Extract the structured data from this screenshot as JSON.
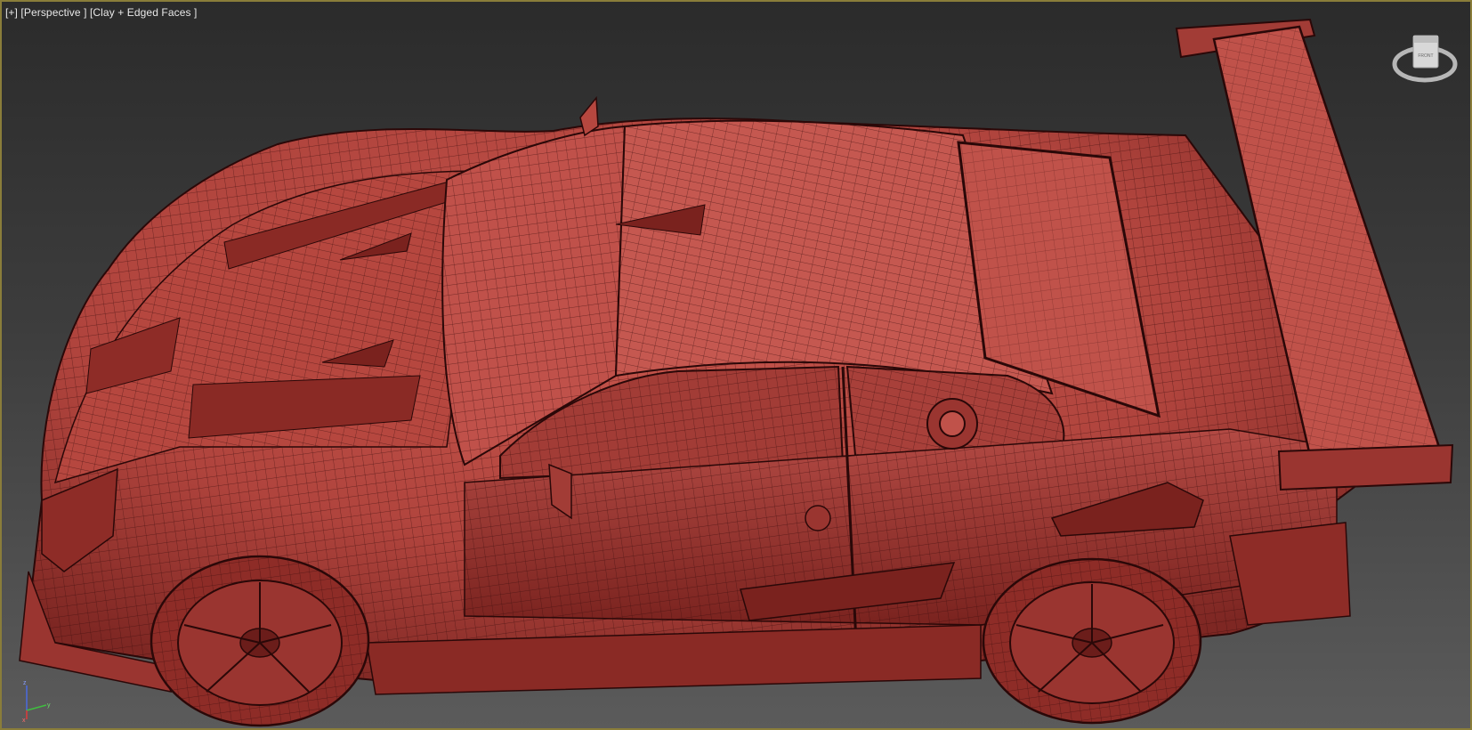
{
  "viewport": {
    "menu_label": "[+]",
    "view_label": "[Perspective ]",
    "shading_label": "[Clay + Edged Faces ]"
  },
  "scene": {
    "object": "race-car-mesh",
    "shading_color": "#b3463f",
    "wire_color": "#3a0c0c",
    "border_color": "#8a7d3a"
  },
  "viewcube": {
    "face_label": "FRONT"
  },
  "axis": {
    "x": "x",
    "y": "y",
    "z": "z"
  }
}
